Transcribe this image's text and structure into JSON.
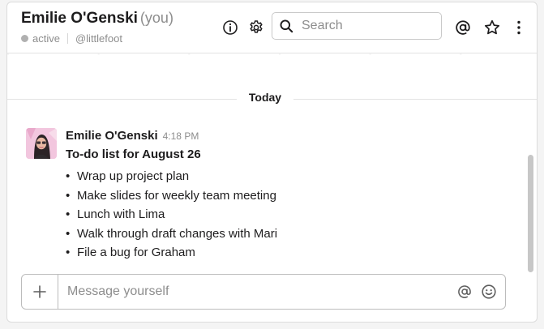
{
  "header": {
    "name": "Emilie O'Genski",
    "you_label": "(you)",
    "status": "active",
    "handle": "@littlefoot",
    "icons": [
      "info-icon",
      "gear-icon",
      "mention-icon",
      "star-icon",
      "more-vertical-icon"
    ]
  },
  "search": {
    "placeholder": "Search",
    "value": ""
  },
  "divider": {
    "label": "Today"
  },
  "message": {
    "author": "Emilie O'Genski",
    "time": "4:18 PM",
    "title": "To-do list for August 26",
    "items": [
      "Wrap up project plan",
      "Make slides for weekly team meeting",
      "Lunch with Lima",
      "Walk through draft changes with Mari",
      "File a bug for Graham"
    ],
    "bullet": "•"
  },
  "composer": {
    "placeholder": "Message yourself",
    "value": "",
    "icons": [
      "plus-icon",
      "mention-icon",
      "emoji-icon"
    ]
  },
  "colors": {
    "text": "#1d1c1d",
    "muted": "#8d8d8d",
    "border": "#c9c9c9",
    "presence_away": "#b0b0b0",
    "avatar_bg": "#f2c6de"
  }
}
